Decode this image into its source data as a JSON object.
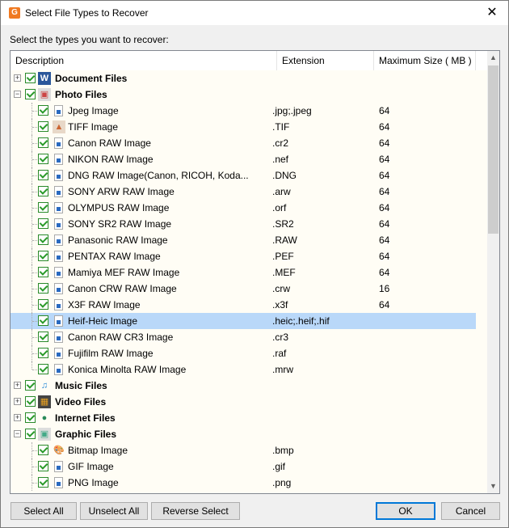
{
  "window": {
    "title": "Select File Types to Recover",
    "app_icon": "app-logo-icon",
    "close_glyph": "✕"
  },
  "prompt": "Select the types you want to recover:",
  "columns": {
    "description": "Description",
    "extension": "Extension",
    "max_size": "Maximum Size ( MB )"
  },
  "rows": [
    {
      "level": 0,
      "expander": "+",
      "label": "Document Files",
      "icon": "word-document-icon",
      "checked": true,
      "ext": "",
      "size": ""
    },
    {
      "level": 0,
      "expander": "−",
      "label": "Photo Files",
      "icon": "photo-folder-icon",
      "checked": true,
      "ext": "",
      "size": ""
    },
    {
      "level": 1,
      "label": "Jpeg Image",
      "icon": "image-file-icon",
      "checked": true,
      "ext": ".jpg;.jpeg",
      "size": "64"
    },
    {
      "level": 1,
      "label": "TIFF Image",
      "icon": "tiff-image-icon",
      "checked": true,
      "ext": ".TIF",
      "size": "64"
    },
    {
      "level": 1,
      "label": "Canon RAW Image",
      "icon": "image-file-icon",
      "checked": true,
      "ext": ".cr2",
      "size": "64"
    },
    {
      "level": 1,
      "label": "NIKON RAW Image",
      "icon": "image-file-icon",
      "checked": true,
      "ext": ".nef",
      "size": "64"
    },
    {
      "level": 1,
      "label": "DNG RAW Image(Canon, RICOH, Koda...",
      "icon": "image-file-icon",
      "checked": true,
      "ext": ".DNG",
      "size": "64"
    },
    {
      "level": 1,
      "label": "SONY ARW RAW Image",
      "icon": "image-file-icon",
      "checked": true,
      "ext": ".arw",
      "size": "64"
    },
    {
      "level": 1,
      "label": "OLYMPUS RAW Image",
      "icon": "image-file-icon",
      "checked": true,
      "ext": ".orf",
      "size": "64"
    },
    {
      "level": 1,
      "label": "SONY SR2 RAW Image",
      "icon": "image-file-icon",
      "checked": true,
      "ext": ".SR2",
      "size": "64"
    },
    {
      "level": 1,
      "label": "Panasonic RAW Image",
      "icon": "image-file-icon",
      "checked": true,
      "ext": ".RAW",
      "size": "64"
    },
    {
      "level": 1,
      "label": "PENTAX RAW Image",
      "icon": "image-file-icon",
      "checked": true,
      "ext": ".PEF",
      "size": "64"
    },
    {
      "level": 1,
      "label": "Mamiya MEF RAW Image",
      "icon": "image-file-icon",
      "checked": true,
      "ext": ".MEF",
      "size": "64"
    },
    {
      "level": 1,
      "label": "Canon CRW RAW Image",
      "icon": "image-file-icon",
      "checked": true,
      "ext": ".crw",
      "size": "16"
    },
    {
      "level": 1,
      "label": "X3F RAW Image",
      "icon": "image-file-icon",
      "checked": true,
      "ext": ".x3f",
      "size": "64"
    },
    {
      "level": 1,
      "label": "Heif-Heic Image",
      "icon": "image-file-icon",
      "checked": true,
      "ext": ".heic;.heif;.hif",
      "size": "",
      "selected": true
    },
    {
      "level": 1,
      "label": "Canon RAW CR3 Image",
      "icon": "image-file-icon",
      "checked": true,
      "ext": ".cr3",
      "size": ""
    },
    {
      "level": 1,
      "label": "Fujifilm RAW Image",
      "icon": "image-file-icon",
      "checked": true,
      "ext": ".raf",
      "size": ""
    },
    {
      "level": 1,
      "label": "Konica Minolta RAW Image",
      "icon": "image-file-icon",
      "checked": true,
      "ext": ".mrw",
      "size": "",
      "last": true
    },
    {
      "level": 0,
      "expander": "+",
      "label": "Music Files",
      "icon": "music-note-icon",
      "checked": true,
      "ext": "",
      "size": ""
    },
    {
      "level": 0,
      "expander": "+",
      "label": "Video Files",
      "icon": "film-strip-icon",
      "checked": true,
      "ext": "",
      "size": ""
    },
    {
      "level": 0,
      "expander": "+",
      "label": "Internet Files",
      "icon": "globe-icon",
      "checked": true,
      "ext": "",
      "size": ""
    },
    {
      "level": 0,
      "expander": "−",
      "label": "Graphic Files",
      "icon": "graphic-folder-icon",
      "checked": true,
      "ext": "",
      "size": ""
    },
    {
      "level": 1,
      "label": "Bitmap Image",
      "icon": "paint-palette-icon",
      "checked": true,
      "ext": ".bmp",
      "size": ""
    },
    {
      "level": 1,
      "label": "GIF Image",
      "icon": "image-file-icon",
      "checked": true,
      "ext": ".gif",
      "size": ""
    },
    {
      "level": 1,
      "label": "PNG Image",
      "icon": "image-file-icon",
      "checked": true,
      "ext": ".png",
      "size": ""
    }
  ],
  "scrollbar": {
    "up_glyph": "▲",
    "down_glyph": "▼",
    "position_fraction": 0.0
  },
  "buttons": {
    "select_all": "Select All",
    "unselect_all": "Unselect All",
    "reverse_select": "Reverse Select",
    "ok": "OK",
    "cancel": "Cancel"
  }
}
